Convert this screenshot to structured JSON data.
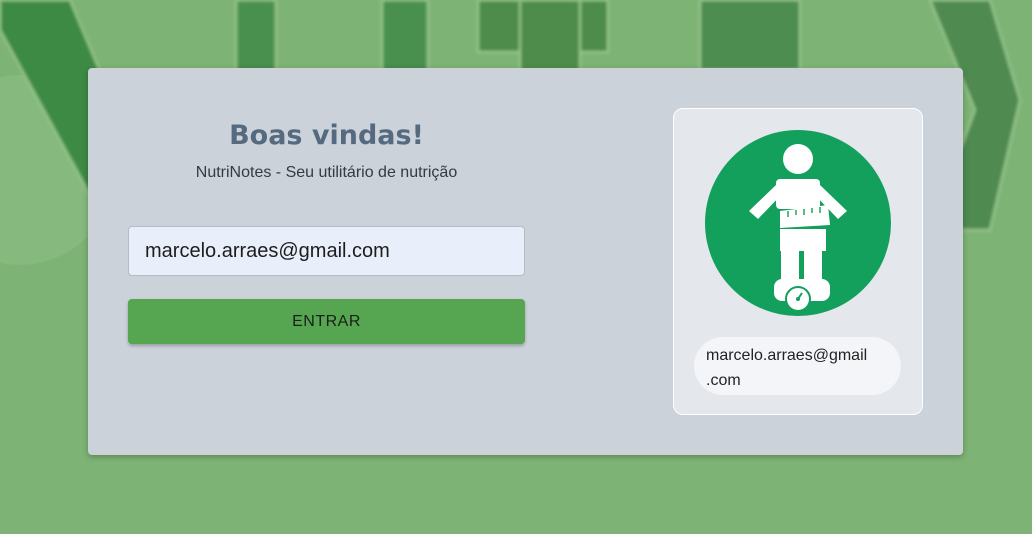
{
  "background": {
    "color": "#7db374"
  },
  "login": {
    "title": "Boas vindas!",
    "subtitle": "NutriNotes - Seu utilitário de nutrição",
    "email_value": "marcelo.arraes@gmail.com",
    "enter_label": "ENTRAR",
    "button_color": "#56a651"
  },
  "profile": {
    "avatar_icon": "body-measurement-icon",
    "avatar_color": "#12a05c",
    "email_line1": "marcelo.arraes@gmail",
    "email_line2": ".com"
  }
}
